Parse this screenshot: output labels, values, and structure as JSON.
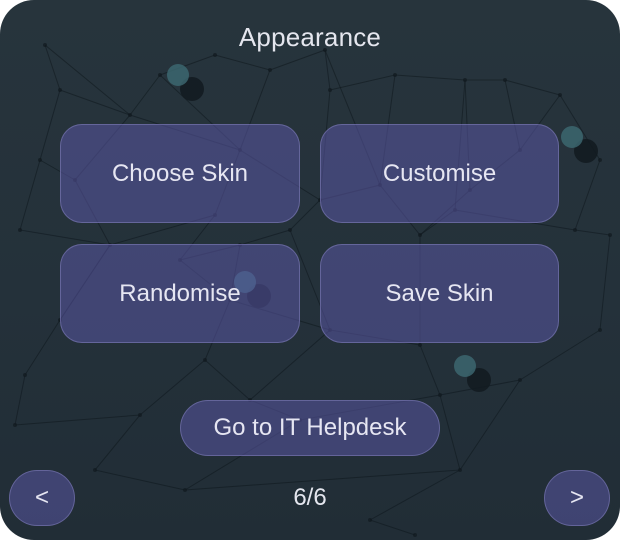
{
  "header": {
    "title": "Appearance"
  },
  "menu": {
    "choose_skin": "Choose Skin",
    "customise": "Customise",
    "randomise": "Randomise",
    "save_skin": "Save Skin"
  },
  "helpdesk": {
    "label": "Go to IT Helpdesk"
  },
  "pagination": {
    "prev_label": "<",
    "next_label": ">",
    "indicator": "6/6"
  },
  "theme": {
    "background": "#24313a",
    "button_fill": "#5c58a8",
    "text": "#e4e6ee"
  }
}
